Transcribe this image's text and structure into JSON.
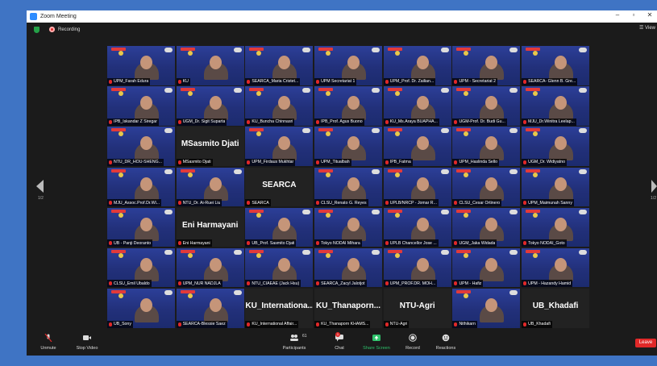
{
  "window": {
    "title": "Zoom Meeting",
    "status": "Recording",
    "view_label": "View",
    "page_left": "1/2",
    "page_right": "1/2",
    "colors": {
      "background": "#3f74c4",
      "toolbar": "#1b1b1b",
      "leave": "#e02828",
      "active_speaker": "#d7e24a"
    }
  },
  "participants": [
    {
      "name": "UPM_Farah Edura"
    },
    {
      "name": "KU"
    },
    {
      "name": "SEARCA_Maria Cristet..."
    },
    {
      "name": "UPM Secretariat 1",
      "active": true
    },
    {
      "name": "UPM_Prof. Dr. Zailian..."
    },
    {
      "name": "UPM - Secretariat 2"
    },
    {
      "name": "SEARCA- Glenn B. Gre..."
    },
    {
      "name": "IPB_Iskandar Z Siregar"
    },
    {
      "name": "UGM_Dr. Sigit Supartа"
    },
    {
      "name": "KU_Buncha Chinnasri"
    },
    {
      "name": "IPB_Prof. Agus Buono"
    },
    {
      "name": "KU_Ms.Araya BUAPHA..."
    },
    {
      "name": "UGM-Prof. Dr. Budi Gu..."
    },
    {
      "name": "MJU_Dr.Winitra Leelap..."
    },
    {
      "name": "NTU_DR_HOU-SHENG..."
    },
    {
      "name": "MSasmito Djati",
      "big": "MSasmito Djati"
    },
    {
      "name": "UPM_Firdaus Mukhtar"
    },
    {
      "name": "UPM_Titualbah"
    },
    {
      "name": "IPB_Fatma"
    },
    {
      "name": "UPM_Haslinda Sello"
    },
    {
      "name": "UGM_Dr. Widiyatno"
    },
    {
      "name": "MJU_Assoc.Prof.Dr.Wi..."
    },
    {
      "name": "NTU_Dr. Ai-Ruei Liu"
    },
    {
      "name": "SEARCA",
      "big": "SEARCA"
    },
    {
      "name": "CLSU_Renato G. Reyes"
    },
    {
      "name": "UPLB/NRCP - Jomar R..."
    },
    {
      "name": "CLSU_Cesar Ortinero"
    },
    {
      "name": "UPM_Maimunah Sanny"
    },
    {
      "name": "UB - Panji Deoranto"
    },
    {
      "name": "Eni Harmayani",
      "big": "Eni Harmayani"
    },
    {
      "name": "UB_Prof. Sasmito Djati"
    },
    {
      "name": "Tokyo NODAI Mihara"
    },
    {
      "name": "UPLB Chancellor Jose ..."
    },
    {
      "name": "UGM_Jaka Widada"
    },
    {
      "name": "Tokyo NODAI_Goto"
    },
    {
      "name": "CLSU_Emil Ubaldo"
    },
    {
      "name": "UPM_NUR NADJLA"
    },
    {
      "name": "NTU_CIAEAE (Jack Hsu)"
    },
    {
      "name": "SEARCA_Zacyl Jalotjot"
    },
    {
      "name": "UPM_PROF.DR. MOH..."
    },
    {
      "name": "UPM - Hafiz"
    },
    {
      "name": "UPM - Hazandy Hamid"
    },
    {
      "name": "UB_Sony"
    },
    {
      "name": "SEARCA-Blessie Saez"
    },
    {
      "name": "KU_International Affair...",
      "big": "KU_Internationa..."
    },
    {
      "name": "KU_Thanaporn KHAMS...",
      "big": "KU_Thanaporn..."
    },
    {
      "name": "NTU-Agri",
      "big": "NTU-Agri"
    },
    {
      "name": "Nithikarn"
    },
    {
      "name": "UB_Khadafi",
      "big": "UB_Khadafi"
    }
  ],
  "toolbar": {
    "unmute": "Unmute",
    "stop_video": "Stop Video",
    "participants": "Participants",
    "participants_count": "61",
    "chat": "Chat",
    "chat_badge": "1",
    "share": "Share Screen",
    "record": "Record",
    "reactions": "Reactions",
    "leave": "Leave"
  }
}
